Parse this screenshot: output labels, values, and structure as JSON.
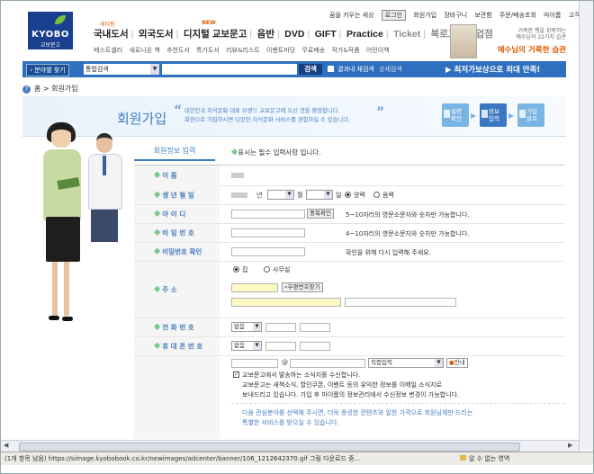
{
  "header": {
    "logo_main": "KYOBO",
    "logo_sub": "교보문고",
    "top_links": [
      "꿈을 키우는 세상",
      "회원가입",
      "장바구니",
      "보관함",
      "주문/배송조회",
      "마이룸",
      "고객센터"
    ],
    "login_label": "로그인",
    "nav": [
      "국내도서",
      "외국도서",
      "디지털 교보문고",
      "음반",
      "DVD",
      "GIFT",
      "Practice",
      "Ticket",
      "북로그",
      "영업점"
    ],
    "nav_tag_new": "NEW",
    "nav_tag_s": "세티핑",
    "subnav": [
      "베스트셀러",
      "새로나온 책",
      "추천도서",
      "특가도서",
      "리뷰&리스트",
      "이벤트마당",
      "무료배송",
      "작가&작품",
      "어린이책"
    ]
  },
  "banner": {
    "line1": "거목한 행을 회복하는",
    "line2": "예수님의 22가지 습관",
    "title": "예수님의 거룩한 습관"
  },
  "search": {
    "category_button": "› 분야별 찾기",
    "select_value": "통합검색",
    "submit": "검색",
    "result_label": "결과내 재검색",
    "advanced": "상세검색",
    "promo": "▶ 최저가보상으로 최대 만족!"
  },
  "breadcrumb": {
    "home": "홈",
    "current": "회원가입"
  },
  "page": {
    "title": "회원가입",
    "desc1": "대한민국 지식문화 대표 브랜드 교보문고에 오신 것을 환영합니다.",
    "desc2": "회원으로 가입하시면 다양한 지식문화 서비스를 경험하실 수 있습니다.",
    "steps": [
      {
        "label1": "실명",
        "label2": "확인"
      },
      {
        "label1": "정보",
        "label2": "입력"
      },
      {
        "label1": "가입",
        "label2": "완료"
      }
    ]
  },
  "form": {
    "tab": "회원정보 입력",
    "required_note": "표시는 필수 입력사항 입니다.",
    "required_mark": "※",
    "labels": {
      "name": "이        름",
      "birth": "생 년 월 일",
      "id": "아   이   디",
      "password": "비 밀 번 호",
      "password_confirm": "비밀번호 확인",
      "address": "주          소",
      "phone": "전 화 번 호",
      "mobile": "휴 대 폰 번 호"
    },
    "birth": {
      "year_suffix": "년",
      "month_suffix": "월",
      "day_suffix": "일",
      "solar": "양력",
      "lunar": "음력"
    },
    "id_check": "중복확인",
    "id_hint": "5~10자리의 영문소문자와 숫자만 가능합니다.",
    "pw_hint": "4~10자리의 영문소문자와 숫자만 가능합니다.",
    "pw_confirm_hint": "확인을 위해 다시 입력해 주세요.",
    "address_home": "집",
    "address_office": "사무실",
    "zip_button": "우편번호찾기",
    "phone_select": "없음",
    "mobile_select": "없음",
    "email_at": "@",
    "email_select": "직접입력",
    "email_info": "안내",
    "newsletter_label": "교보문고에서 발송하는 소식지를 수신합니다.",
    "newsletter_desc1": "교보문고는 새책소식, 할인쿠폰, 이벤트 등의 유익한 정보를 이메일 소식지로",
    "newsletter_desc2": "보내드리고 있습니다. 가입 후 마이룸의 정보관리에서 수신정보 변경이 가능합니다.",
    "interest_1": "다음 관심분야를 선택해 주시면, 더욱 풍성한 컨텐츠와 알찬 가격으로 회원님께만 드리는",
    "interest_2": "특별한 서비스를 받으실 수 있습니다."
  },
  "statusbar": {
    "left": "(1개 항목 남음) https://simage.kyobobook.co.kr/newimages/adcenter/banner/106_1212642370.gif 그림 다운로드 중...",
    "right": "알 수 없는 영역"
  },
  "colors": {
    "brand": "#1a3f8f",
    "accent": "#3f7fbf",
    "required": "#3cae5c",
    "promo": "#e05a00"
  }
}
